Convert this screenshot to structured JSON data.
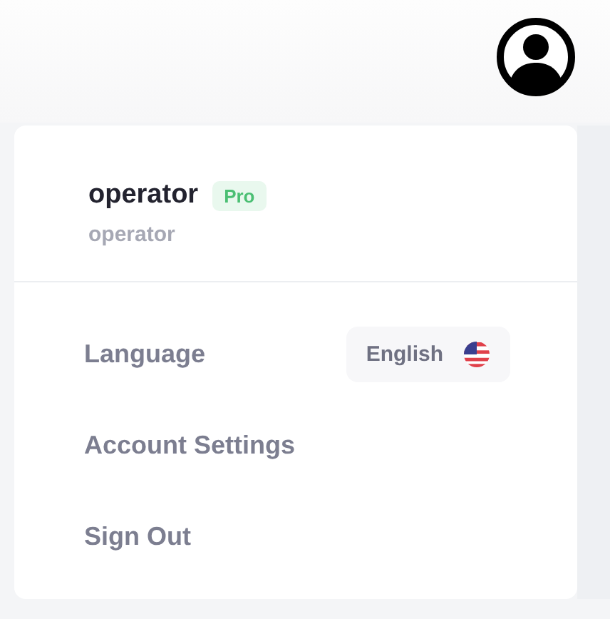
{
  "user": {
    "name": "operator",
    "badge": "Pro",
    "subtitle": "operator"
  },
  "menu": [
    {
      "kind": "select",
      "label": "Language",
      "value": "English"
    },
    {
      "kind": "link",
      "label": "Account Settings"
    },
    {
      "kind": "link",
      "label": "Sign Out"
    }
  ]
}
